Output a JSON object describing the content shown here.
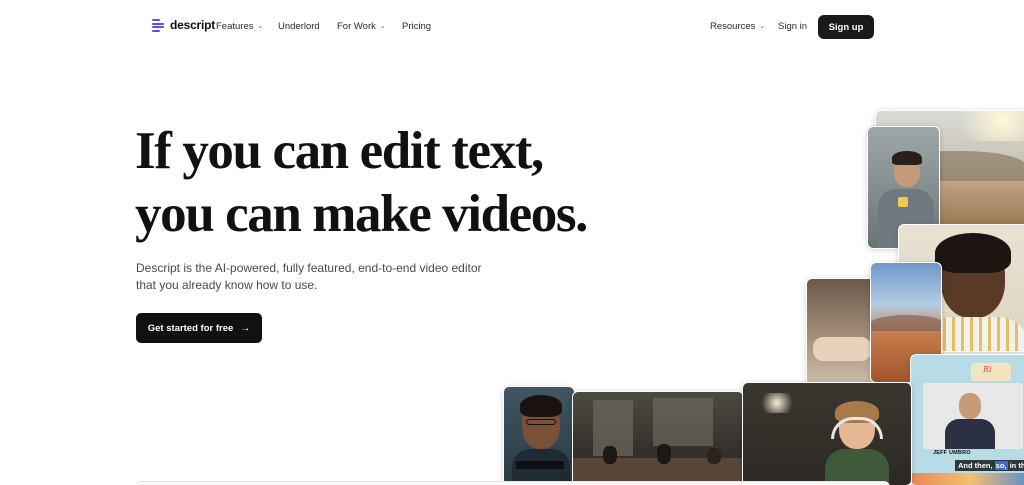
{
  "nav": {
    "logo_text": "descript",
    "features": "Features",
    "underlord": "Underlord",
    "for_work": "For Work",
    "pricing": "Pricing",
    "resources": "Resources",
    "sign_in": "Sign in",
    "sign_up": "Sign up"
  },
  "hero": {
    "headline_line1": "If you can edit text,",
    "headline_line2": "you can make videos.",
    "subtext": "Descript is the AI-powered, fully featured, end-to-end video editor that you already know how to use.",
    "cta": "Get started for free"
  },
  "collage": {
    "name_tag": "JEFF UMBRO",
    "caption_before": "And then, ",
    "caption_highlight": "so,",
    "caption_after": " in the"
  },
  "colors": {
    "brand": "#5b4ef0",
    "button_dark": "#111111",
    "caption_highlight": "#3a6bd6"
  }
}
